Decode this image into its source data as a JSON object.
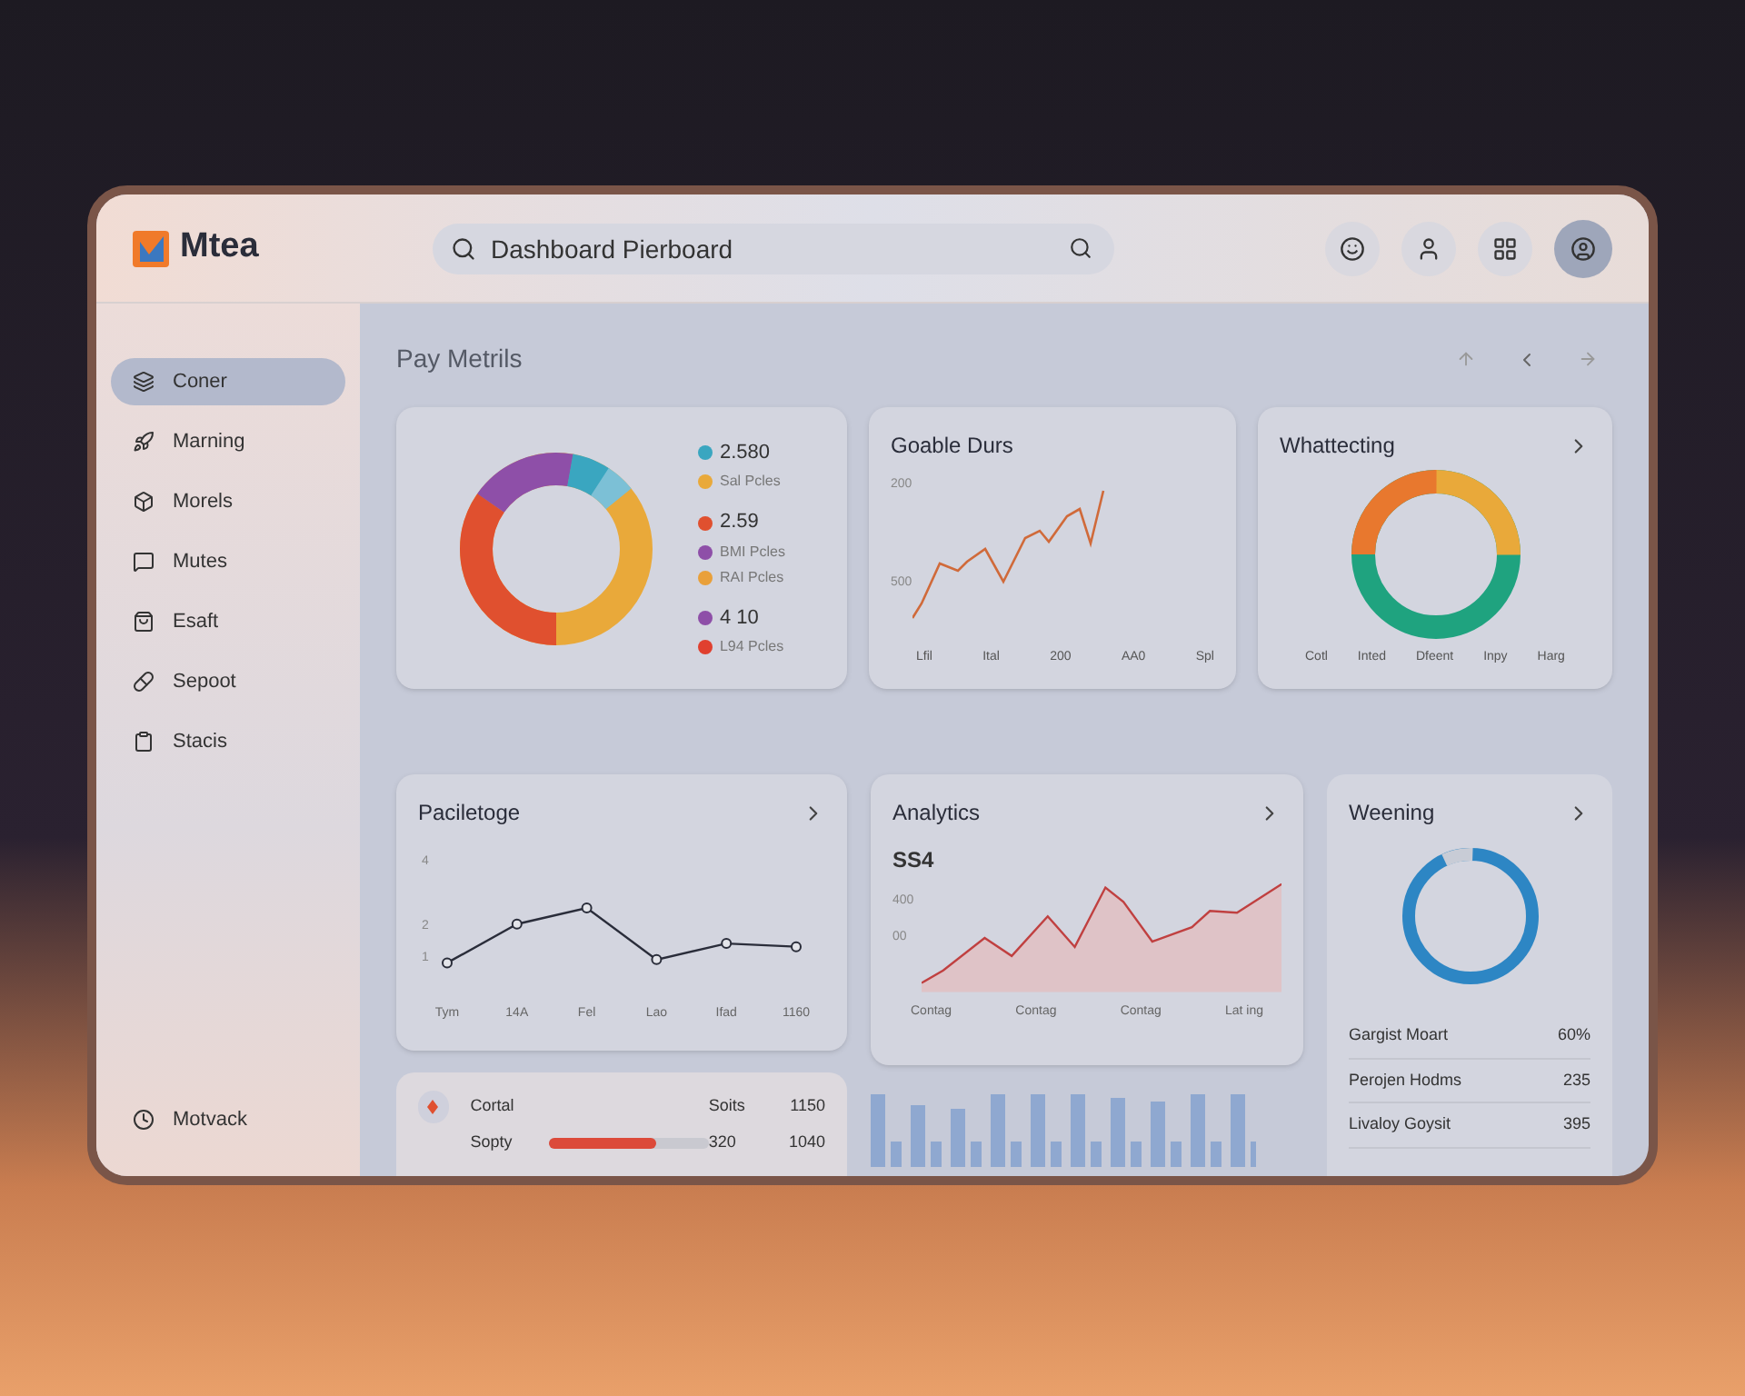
{
  "app": {
    "logo": "Mtea"
  },
  "search": {
    "value": "Dashboard Pierboard"
  },
  "header_buttons": [
    {
      "selected": false
    },
    {
      "selected": false
    },
    {
      "selected": false
    },
    {
      "selected": true
    }
  ],
  "sidebar": {
    "items": [
      {
        "label": "Coner",
        "selected": true
      },
      {
        "label": "Marning",
        "selected": false
      },
      {
        "label": "Morels",
        "selected": false
      },
      {
        "label": "Mutes",
        "selected": false
      },
      {
        "label": "Esaft",
        "selected": false
      },
      {
        "label": "Sepoot",
        "selected": false
      },
      {
        "label": "Stacis",
        "selected": false
      }
    ],
    "footer": {
      "label": "Motvack"
    }
  },
  "page_title": "Pay Metrils",
  "legend": [
    {
      "text": "2.580",
      "kind": "value",
      "color": "#3aa6c0"
    },
    {
      "text": "Sal Pcles",
      "kind": "label",
      "color": "#e9a93a"
    },
    {
      "text": "2.59",
      "kind": "value",
      "color": "#e0502f"
    },
    {
      "text": "BMI Pcles",
      "kind": "label",
      "color": "#8e4fa8"
    },
    {
      "text": "RAI Pcles",
      "kind": "label",
      "color": "#e9a03a"
    },
    {
      "text": "4 10",
      "kind": "value",
      "color": "#8e4fa8"
    },
    {
      "text": "L94 Pcles",
      "kind": "label",
      "color": "#e0402f"
    }
  ],
  "goable": {
    "title": "Goable Durs",
    "yticks": [
      "200",
      "500"
    ],
    "xlabels": [
      "Lfil",
      "Ital",
      "200",
      "AA0",
      "Spl"
    ]
  },
  "whattecting": {
    "title": "Whattecting",
    "xlabels": [
      "Cotl",
      "Inted",
      "Dfeent",
      "Inpy",
      "Harg"
    ]
  },
  "paciletoge": {
    "title": "Paciletoge",
    "chart_data": {
      "type": "line",
      "categories": [
        "Tym",
        "14A",
        "Fel",
        "Lao",
        "Ifad",
        "1160"
      ],
      "series": [
        {
          "color": "#2a2d3a",
          "marker": "circle",
          "values": [
            0.8,
            2.0,
            2.5,
            0.9,
            1.4,
            1.3
          ]
        }
      ],
      "ylim": [
        -1.86,
        6.69
      ],
      "yticks": [
        1,
        2,
        4
      ]
    }
  },
  "analytics": {
    "title": "Analytics",
    "value": "SS4",
    "yticks": [
      "400",
      "00"
    ],
    "xlabels": [
      "Contag",
      "Contag",
      "Contag",
      "Lat ing"
    ]
  },
  "weening": {
    "title": "Weening",
    "rows": [
      {
        "label": "Gargist Moart",
        "value": "60%"
      },
      {
        "label": "Perojen Hodms",
        "value": "235"
      },
      {
        "label": "Livaloy Goysit",
        "value": "395"
      }
    ]
  },
  "summary": {
    "rows": [
      {
        "label": "Cortal",
        "col_2": "Soits",
        "col_3": "1150"
      },
      {
        "label": "Sopty",
        "level": 0.67,
        "col_2": "320",
        "col_3": "1040"
      }
    ]
  }
}
